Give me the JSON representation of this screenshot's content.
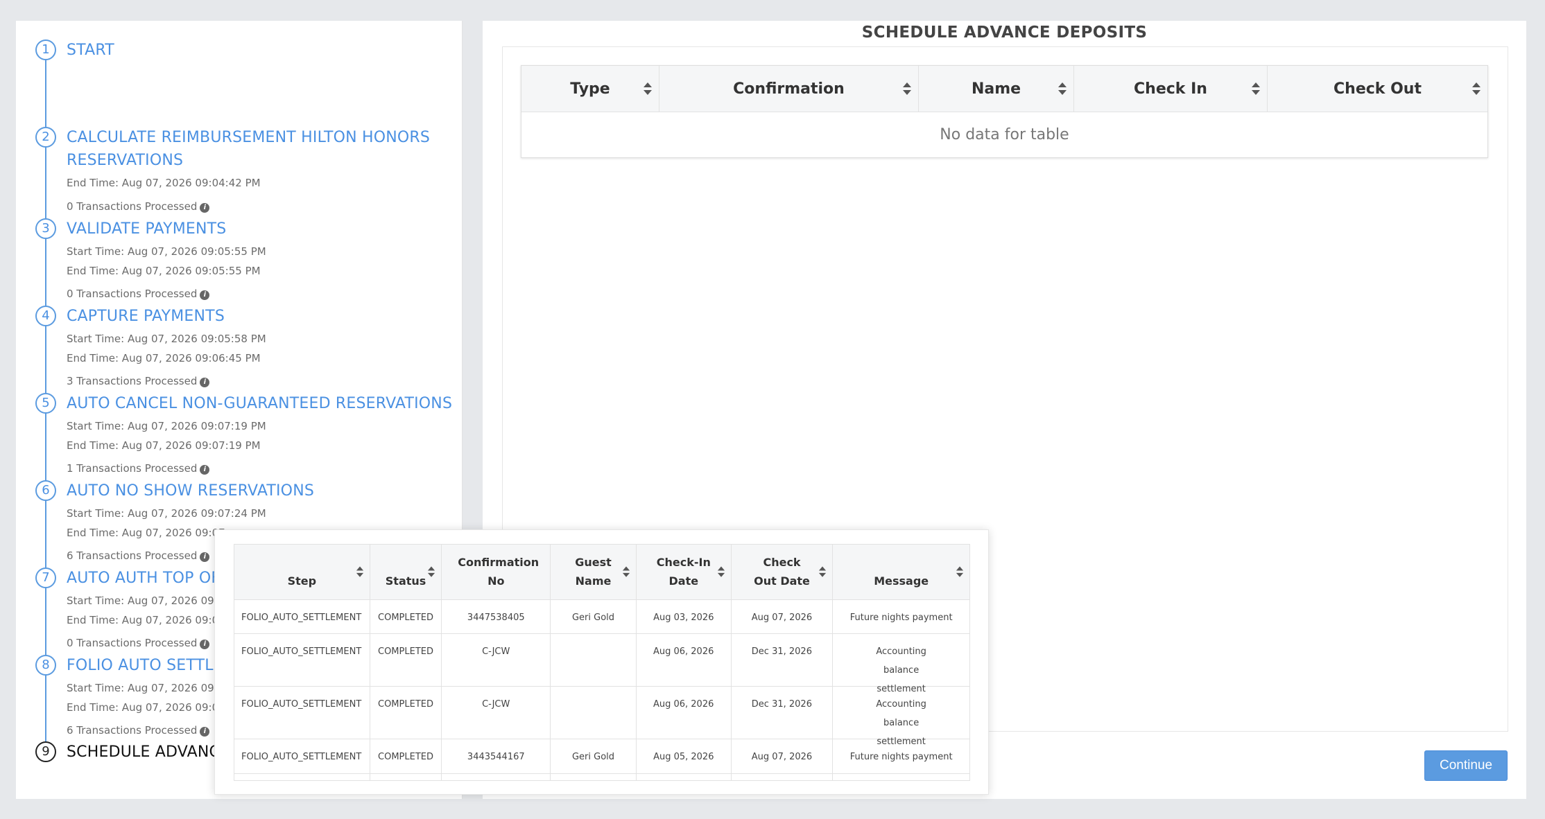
{
  "stepper": {
    "steps": [
      {
        "number": "1",
        "title": "START",
        "lines": []
      },
      {
        "number": "2",
        "title": "CALCULATE REIMBURSEMENT HILTON HONORS RESERVATIONS",
        "lines": [
          "End Time: Aug 07, 2026 09:04:42 PM"
        ],
        "count": "0 Transactions Processed"
      },
      {
        "number": "3",
        "title": "VALIDATE PAYMENTS",
        "lines": [
          "Start Time: Aug 07, 2026 09:05:55 PM",
          "End Time: Aug 07, 2026 09:05:55 PM"
        ],
        "count": "0 Transactions Processed"
      },
      {
        "number": "4",
        "title": "CAPTURE PAYMENTS",
        "lines": [
          "Start Time: Aug 07, 2026 09:05:58 PM",
          "End Time: Aug 07, 2026 09:06:45 PM"
        ],
        "count": "3 Transactions Processed"
      },
      {
        "number": "5",
        "title": "AUTO CANCEL NON-GUARANTEED RESERVATIONS",
        "lines": [
          "Start Time: Aug 07, 2026 09:07:19 PM",
          "End Time: Aug 07, 2026 09:07:19 PM"
        ],
        "count": "1 Transactions Processed"
      },
      {
        "number": "6",
        "title": "AUTO NO SHOW RESERVATIONS",
        "lines": [
          "Start Time: Aug 07, 2026 09:07:24 PM",
          "End Time: Aug 07, 2026 09:07"
        ],
        "count": "6 Transactions Processed"
      },
      {
        "number": "7",
        "title": "AUTO AUTH TOP OFF",
        "lines": [
          "Start Time: Aug 07, 2026 09:0",
          "End Time: Aug 07, 2026 09:07"
        ],
        "count": "0 Transactions Processed"
      },
      {
        "number": "8",
        "title": "FOLIO AUTO SETTLEM",
        "lines": [
          "Start Time: Aug 07, 2026 09:0",
          "End Time: Aug 07, 2026 09:08"
        ],
        "count": "6 Transactions Processed"
      },
      {
        "number": "9",
        "title": "SCHEDULE ADVANC",
        "lines": []
      }
    ]
  },
  "main": {
    "title": "SCHEDULE ADVANCE DEPOSITS",
    "columns": [
      "Type",
      "Confirmation",
      "Name",
      "Check In",
      "Check Out"
    ],
    "empty_text": "No data for table",
    "continue_label": "Continue"
  },
  "popup": {
    "columns": [
      "Step",
      "Status",
      "Confirmation No",
      "Guest Name",
      "Check-In Date",
      "Check Out Date",
      "Message"
    ],
    "rows": [
      [
        "FOLIO_AUTO_SETTLEMENT",
        "COMPLETED",
        "3447538405",
        "Geri Gold",
        "Aug 03, 2026",
        "Aug 07, 2026",
        "Future nights payment"
      ],
      [
        "FOLIO_AUTO_SETTLEMENT",
        "COMPLETED",
        "C-JCW",
        "",
        "Aug 06, 2026",
        "Dec 31, 2026",
        "Accounting balance settlement"
      ],
      [
        "FOLIO_AUTO_SETTLEMENT",
        "COMPLETED",
        "C-JCW",
        "",
        "Aug 06, 2026",
        "Dec 31, 2026",
        "Accounting balance settlement"
      ],
      [
        "FOLIO_AUTO_SETTLEMENT",
        "COMPLETED",
        "3443544167",
        "Geri Gold",
        "Aug 05, 2026",
        "Aug 07, 2026",
        "Future nights payment"
      ]
    ]
  },
  "colors": {
    "accent": "#4a90e2",
    "button": "#5b9be0"
  }
}
